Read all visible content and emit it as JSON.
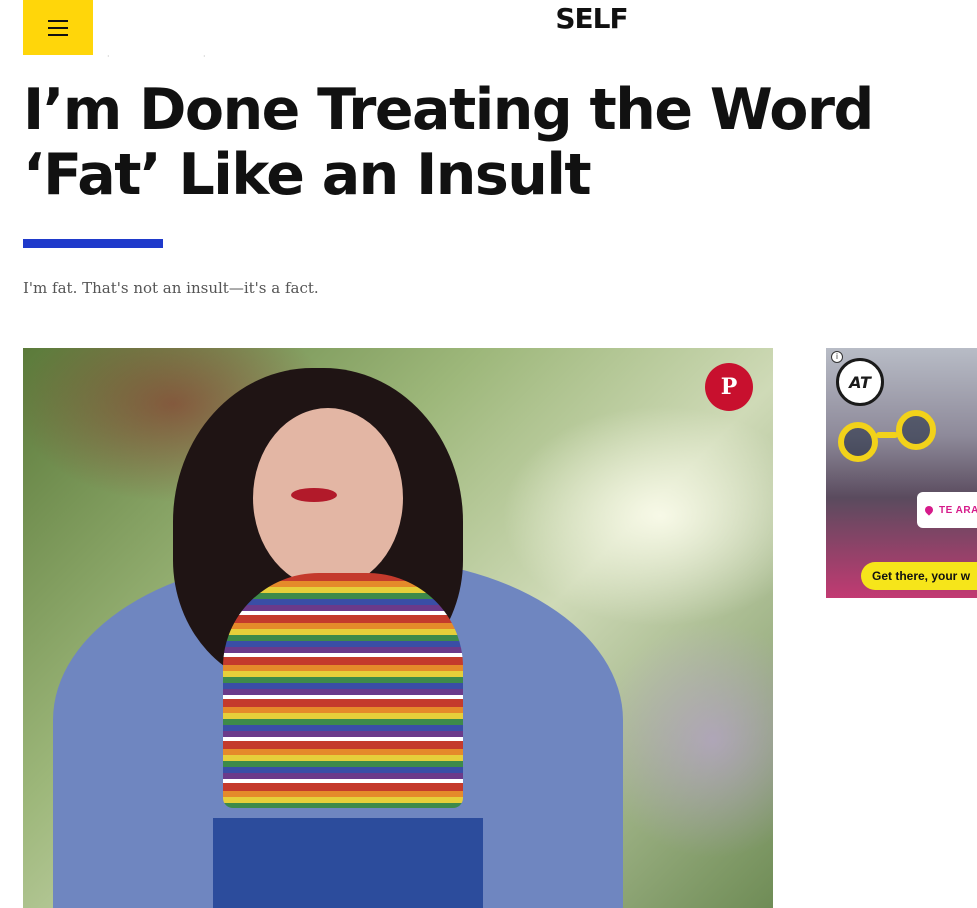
{
  "header": {
    "menu_label": "Menu",
    "logo": "SELF"
  },
  "article": {
    "headline": "I’m Done Treating the Word ‘Fat’ Like an Insult",
    "dek": "I'm fat. That's not an insult—it's a fact."
  },
  "hero": {
    "pin_label": "P"
  },
  "ad": {
    "info": "i",
    "logo_text": "AT",
    "location": "TE ARA I",
    "cta": "Get there, your w"
  }
}
